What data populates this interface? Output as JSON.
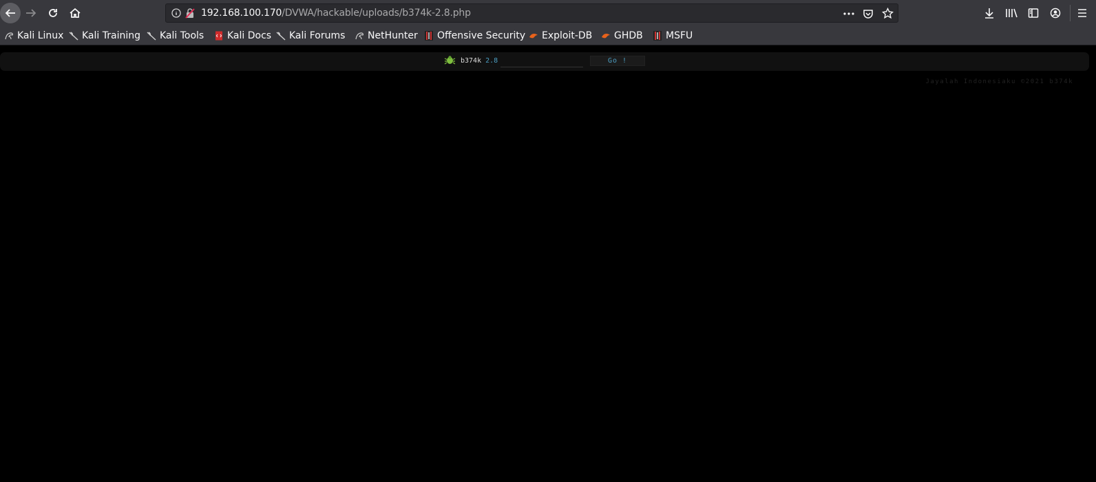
{
  "browser": {
    "url_host": "192.168.100.170",
    "url_path": "/DVWA/hackable/uploads/b374k-2.8.php",
    "nav": {
      "back_icon": "arrow-left-icon",
      "forward_icon": "arrow-right-icon",
      "reload_icon": "reload-icon",
      "home_icon": "home-icon"
    }
  },
  "bookmarks": [
    {
      "label": "Kali Linux",
      "icon": "kali-dragon-icon"
    },
    {
      "label": "Kali Training",
      "icon": "kali-dragon-icon"
    },
    {
      "label": "Kali Tools",
      "icon": "kali-dragon-icon"
    },
    {
      "label": "Kali Docs",
      "icon": "docs-icon"
    },
    {
      "label": "Kali Forums",
      "icon": "kali-dragon-icon"
    },
    {
      "label": "NetHunter",
      "icon": "nethunter-icon"
    },
    {
      "label": "Offensive Security",
      "icon": "offsec-icon"
    },
    {
      "label": "Exploit-DB",
      "icon": "exploitdb-icon"
    },
    {
      "label": "GHDB",
      "icon": "exploitdb-icon"
    },
    {
      "label": "MSFU",
      "icon": "offsec-icon"
    }
  ],
  "shell": {
    "brand": "b374k",
    "version": "2.8",
    "input_value": "",
    "go_label": "Go !",
    "footer": "Jayalah Indonesiaku ©2021 b374k"
  },
  "colors": {
    "toolbar": "#38383d",
    "page_bg": "#000000",
    "accent": "#4c9fc4"
  }
}
